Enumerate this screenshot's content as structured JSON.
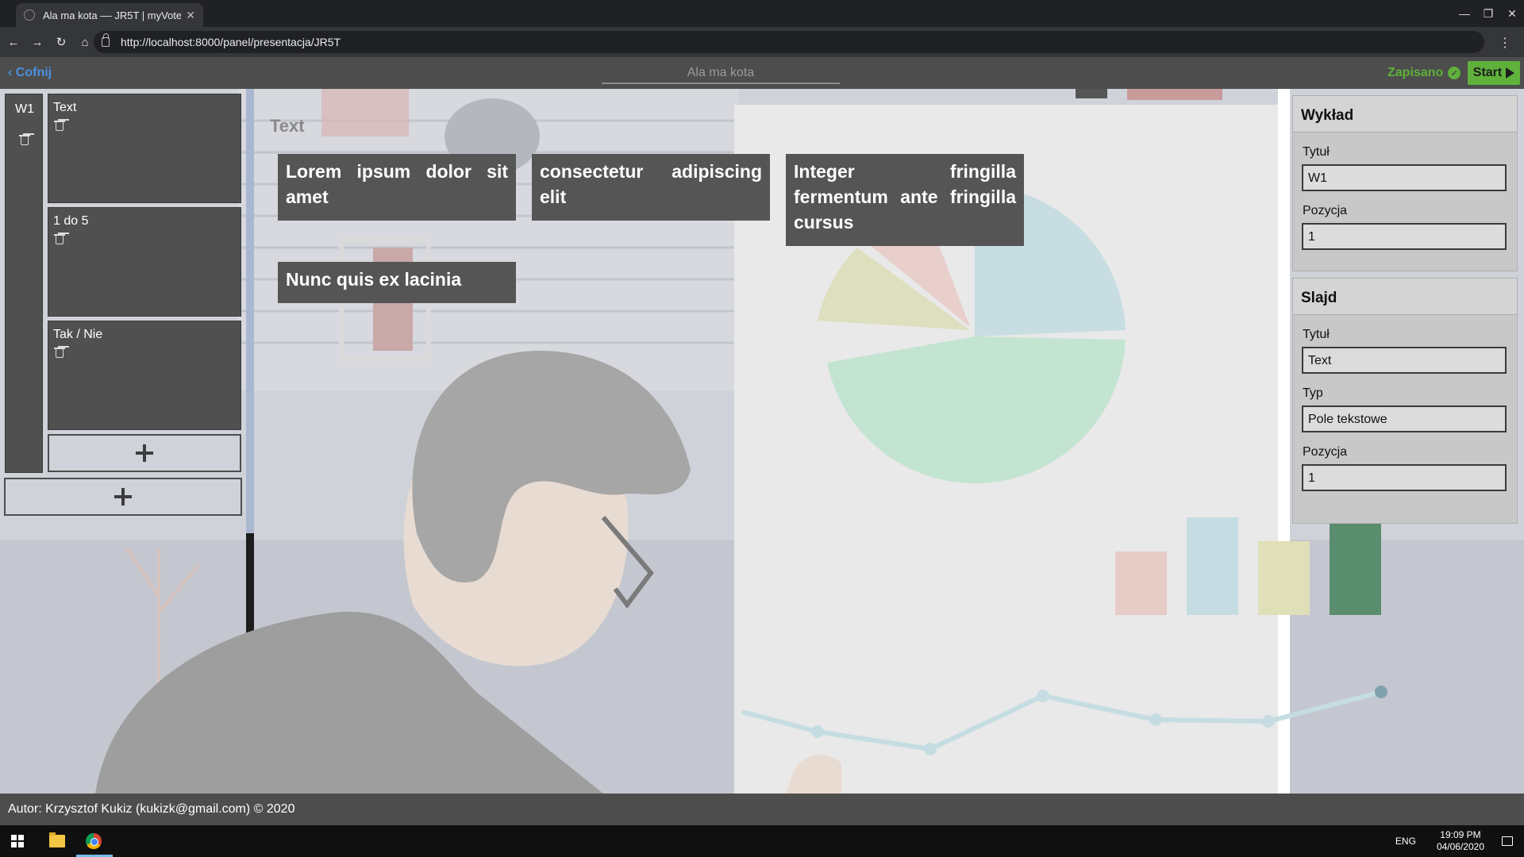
{
  "browser": {
    "tab_title": "Ala ma kota –– JR5T | myVote",
    "url": "http://localhost:8000/panel/presentacja/JR5T",
    "tab_close": "✕",
    "minimize": "—",
    "restore": "❐",
    "close": "✕",
    "back": "←",
    "forward": "→",
    "reload": "↻",
    "home": "⌂",
    "menu": "⋮"
  },
  "header": {
    "back_label": "Cofnij",
    "back_icon": "‹",
    "presentation_title": "Ala ma kota",
    "saved_label": "Zapisano",
    "saved_check": "✓",
    "start_label": "Start",
    "accent_blue": "#4a90e2",
    "accent_green": "#5fb13b"
  },
  "sidebar": {
    "lecture_label": "W1",
    "slides": [
      {
        "label": "Text"
      },
      {
        "label": "1 do 5"
      },
      {
        "label": "Tak / Nie"
      }
    ]
  },
  "slide": {
    "heading": "Text",
    "boxes": [
      {
        "text": "Lorem ipsum dolor sit amet"
      },
      {
        "text": "consectetur adipiscing elit"
      },
      {
        "text": "Integer fringilla fermentum ante fringilla cursus"
      },
      {
        "text": "Nunc quis ex lacinia"
      }
    ]
  },
  "panel": {
    "lecture": {
      "heading": "Wykład",
      "title_label": "Tytuł",
      "title_value": "W1",
      "position_label": "Pozycja",
      "position_value": "1"
    },
    "slide": {
      "heading": "Slajd",
      "title_label": "Tytuł",
      "title_value": "Text",
      "type_label": "Typ",
      "type_value": "Pole tekstowe",
      "position_label": "Pozycja",
      "position_value": "1"
    }
  },
  "footer": {
    "text": "Autor: Krzysztof Kukiz (kukizk@gmail.com) © 2020"
  },
  "taskbar": {
    "lang": "ENG",
    "time": "19:09 PM",
    "date": "04/06/2020"
  }
}
